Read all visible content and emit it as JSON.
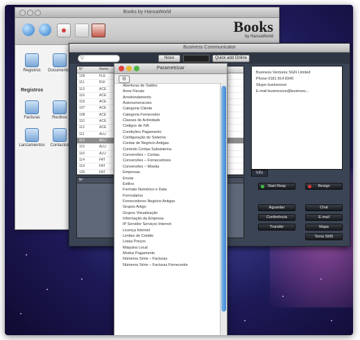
{
  "books_window": {
    "title": "Books by HansaWorld",
    "logo_big": "Books",
    "logo_small": "by HansaWorld",
    "toolbar_icons": [
      "globe-icon",
      "globe-icon",
      "clock-icon",
      "document-icon",
      "photo-icon"
    ],
    "sidebar": {
      "items_top": [
        "Registros",
        "Documentos"
      ],
      "group": "Registros",
      "items": [
        "Facturas",
        "Recibos",
        "Lanzamientos",
        "Contactos"
      ]
    }
  },
  "business_window": {
    "title": "Business Communicator",
    "search_placeholder": "Q",
    "new_button": "Novo",
    "quick_button": "Quick add Online",
    "grid": {
      "headers": [
        "N°",
        "Nome"
      ],
      "rows": [
        [
          "109",
          "FLE"
        ],
        [
          "111",
          "RUI"
        ],
        [
          "113",
          "ACE"
        ],
        [
          "116",
          "ACE"
        ],
        [
          "118",
          "ACE"
        ],
        [
          "107",
          "ACE"
        ],
        [
          "108",
          "ACE"
        ],
        [
          "110",
          "ACE"
        ],
        [
          "112",
          "ACE"
        ],
        [
          "111",
          "ALU"
        ],
        [
          "112",
          "ALU"
        ],
        [
          "115",
          "ALU"
        ],
        [
          "116",
          "ALU"
        ],
        [
          "114",
          "FAT"
        ],
        [
          "119",
          "FAT"
        ],
        [
          "120",
          "FAT"
        ],
        [
          "120",
          "FAT"
        ]
      ],
      "selected_row": 10
    },
    "card": {
      "name": "Business Ventures SGN Limited",
      "phone": "Phone 0181 814 8340",
      "skype": "Skype businessve",
      "email": "E-mail businessve@business..."
    },
    "tab": "Info",
    "lower_header": "Nº",
    "action_buttons": {
      "start_resp": "Start Resp",
      "resign": "Resign",
      "aguardar": "Aguardar",
      "chat": "Chat",
      "conferencia": "Conferência",
      "email": "E-mail",
      "transfer": "Transfer",
      "mapa": "Mapa",
      "toma_sms": "Toma SMS"
    }
  },
  "param_dialog": {
    "title": "Parametrizar",
    "items": [
      "Aberturas de Saldos",
      "Anos Fiscais",
      "Arredondamento",
      "Autonumeracoes",
      "Categoria Cliente",
      "Categoria Fornecedor",
      "Classes de Actividade",
      "Códigos de IVA",
      "Condições Pagamento",
      "Configuração do Sistema",
      "Contas de Negócio Antigas",
      "Controlo Contas Subsistema",
      "Conversões – Contas",
      "Conversões – Fornecedores",
      "Conversões – Moeda",
      "Empresas",
      "Enviar",
      "Estilos",
      "Formato Numérico e Data",
      "Formulários",
      "Fornecedores Negócio Antigas",
      "Grupos Artigo",
      "Grupos Visualização",
      "Informação da Empresa",
      "IP Servidor Serviços Internet",
      "Licença Internet",
      "Limites de Crédito",
      "Listas Preços",
      "Máquina Local",
      "Modos Pagamento",
      "Números Série – Facturas",
      "Números Série – Facturas Fornecedor"
    ]
  },
  "colors": {
    "desktop": "#2a2a78",
    "selection": "#8d8d8d",
    "scroll_thumb": "#4a8fd8",
    "traffic_red": "#e0443e",
    "traffic_yellow": "#e6b82c",
    "traffic_green": "#4fb544"
  }
}
